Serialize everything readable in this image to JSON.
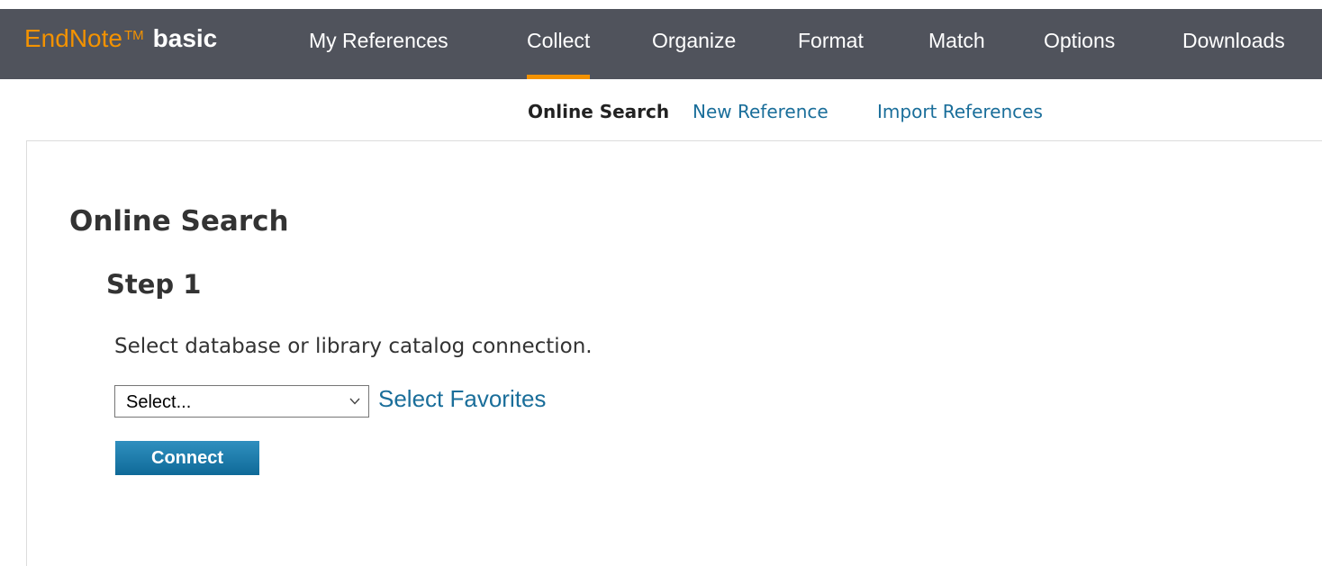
{
  "brand": {
    "name": "EndNote",
    "trademark": "TM",
    "edition": "basic",
    "accent_color": "#f39200"
  },
  "nav": {
    "items": [
      {
        "label": "My References"
      },
      {
        "label": "Collect",
        "active": true
      },
      {
        "label": "Organize"
      },
      {
        "label": "Format"
      },
      {
        "label": "Match"
      },
      {
        "label": "Options"
      },
      {
        "label": "Downloads"
      }
    ]
  },
  "subnav": {
    "current": "Online Search",
    "links": [
      "New Reference",
      "Import References"
    ]
  },
  "main": {
    "title": "Online Search",
    "step": "Step 1",
    "instruction": "Select database or library catalog connection.",
    "select_value": "Select...",
    "favorites_link": "Select Favorites",
    "connect_label": "Connect"
  },
  "colors": {
    "topbar": "#50535c",
    "link": "#1a6e9a",
    "button": "#0f6a98"
  },
  "icons": {
    "select_arrow": "chevron-down-icon"
  }
}
